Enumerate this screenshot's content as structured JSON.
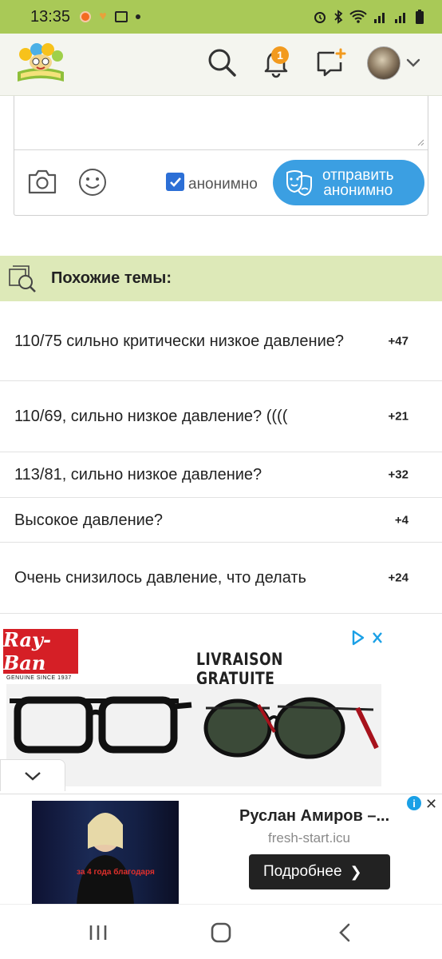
{
  "status_bar": {
    "time": "13:35"
  },
  "header": {
    "notification_count": "1"
  },
  "comment_form": {
    "anonymous_label": "анонимно",
    "send_button_label": "отправить\nанонимно"
  },
  "similar_topics": {
    "title": "Похожие темы:",
    "items": [
      {
        "text": "110/75 сильно критически низкое давление?",
        "count": "+47"
      },
      {
        "text": "110/69, сильно низкое давление? ((((",
        "count": "+21"
      },
      {
        "text": "113/81, сильно низкое давление?",
        "count": "+32"
      },
      {
        "text": "Высокое давление?",
        "count": "+4"
      },
      {
        "text": "Очень снизилось давление, что делать",
        "count": "+24"
      }
    ]
  },
  "ad_rayban": {
    "logo_text": "Ray-Ban",
    "logo_subtext": "GENUINE SINCE 1937",
    "headline": "LIVRAISON GRATUITE"
  },
  "ad_video": {
    "title": "Руслан Амиров –...",
    "domain": "fresh-start.icu",
    "button_label": "Подробнее",
    "video_caption": "за 4 года благодаря"
  },
  "colors": {
    "brand_green": "#a9c957",
    "section_green": "#dde9b8",
    "send_blue": "#3b9fe2",
    "badge_orange": "#f29a1e"
  }
}
